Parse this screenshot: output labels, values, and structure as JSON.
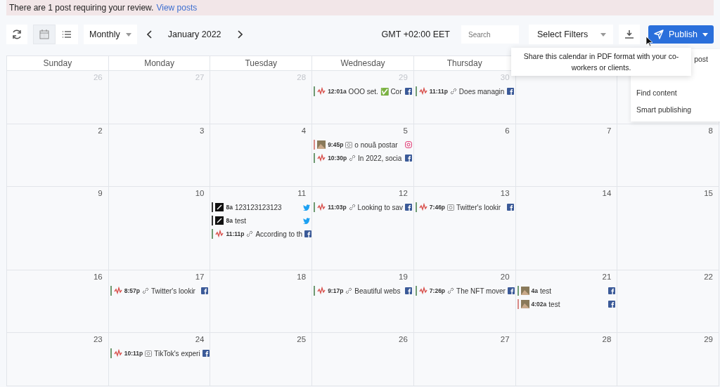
{
  "banner": {
    "text": "There are 1 post requiring your review.",
    "link": "View posts"
  },
  "toolbar": {
    "views": [
      {
        "kind": "calendar",
        "selected": true
      },
      {
        "kind": "list",
        "selected": false
      }
    ],
    "period": "Monthly",
    "month": "January 2022",
    "timezone": "GMT +02:00 EET",
    "search": {
      "placeholder": "Search"
    },
    "filters": "Select Filters",
    "publish": "Publish"
  },
  "tooltip": "Share this calendar in PDF format with your co-workers or clients.",
  "publish_menu": [
    "post",
    "Find content",
    "Smart publishing"
  ],
  "weekdays": [
    "Sunday",
    "Monday",
    "Tuesday",
    "Wednesday",
    "Thursday"
  ],
  "weeks": [
    [
      {
        "day": "26",
        "muted": true
      },
      {
        "day": "27",
        "muted": true
      },
      {
        "day": "28",
        "muted": true
      },
      {
        "day": "29",
        "muted": true,
        "posts": [
          {
            "time": "12:01a",
            "text": "OOO set. ✅ Cor",
            "avatar": {
              "kind": "logo"
            },
            "network": {
              "kind": "facebook"
            },
            "color": "#6f9a72"
          }
        ]
      },
      {
        "day": "30",
        "muted": true,
        "posts": [
          {
            "time": "11:11p",
            "text": "Does managin",
            "avatar": {
              "kind": "logo"
            },
            "media": {
              "kind": "link"
            },
            "network": {
              "kind": "facebook"
            },
            "color": "#6f9a72"
          }
        ]
      }
    ],
    [
      {
        "day": "2",
        "muted": false
      },
      {
        "day": "3",
        "muted": false
      },
      {
        "day": "4",
        "muted": false
      },
      {
        "day": "5",
        "muted": false,
        "posts": [
          {
            "time": "9:45p",
            "text": "o nouă postar",
            "avatar": {
              "kind": "photo"
            },
            "media": {
              "kind": "camera"
            },
            "network": {
              "kind": "instagram"
            },
            "color": "#d98a86"
          },
          {
            "time": "10:30p",
            "text": "In 2022, socia",
            "avatar": {
              "kind": "logo"
            },
            "media": {
              "kind": "link"
            },
            "network": {
              "kind": "facebook"
            },
            "color": "#6f9a72"
          }
        ]
      },
      {
        "day": "6",
        "muted": false
      },
      {
        "day": "7",
        "muted": false
      },
      {
        "day": "8",
        "muted": false
      }
    ],
    [
      {
        "day": "9",
        "muted": false
      },
      {
        "day": "10",
        "muted": false
      },
      {
        "day": "11",
        "muted": false,
        "posts": [
          {
            "time": "8a",
            "text": "123123123123",
            "avatar": {
              "kind": "dark"
            },
            "network": {
              "kind": "twitter"
            },
            "color": "#333333"
          },
          {
            "time": "8a",
            "text": "test",
            "avatar": {
              "kind": "dark"
            },
            "network": {
              "kind": "twitter"
            },
            "color": "#333333"
          },
          {
            "time": "11:11p",
            "text": "According to th",
            "avatar": {
              "kind": "logo"
            },
            "media": {
              "kind": "link"
            },
            "network": {
              "kind": "facebook"
            },
            "color": "#6f9a72"
          }
        ]
      },
      {
        "day": "12",
        "muted": false,
        "posts": [
          {
            "time": "11:03p",
            "text": "Looking to sav",
            "avatar": {
              "kind": "logo"
            },
            "media": {
              "kind": "link"
            },
            "network": {
              "kind": "facebook"
            },
            "color": "#6f9a72"
          }
        ]
      },
      {
        "day": "13",
        "muted": false,
        "posts": [
          {
            "time": "7:46p",
            "text": "Twitter's lookir",
            "avatar": {
              "kind": "logo"
            },
            "media": {
              "kind": "camera"
            },
            "network": {
              "kind": "facebook"
            },
            "color": "#6f9a72"
          }
        ]
      },
      {
        "day": "14",
        "muted": false
      },
      {
        "day": "15",
        "muted": false
      }
    ],
    [
      {
        "day": "16",
        "muted": false
      },
      {
        "day": "17",
        "muted": false,
        "posts": [
          {
            "time": "8:57p",
            "text": "Twitter's lookir",
            "avatar": {
              "kind": "logo"
            },
            "media": {
              "kind": "link"
            },
            "network": {
              "kind": "facebook"
            },
            "color": "#6f9a72"
          }
        ]
      },
      {
        "day": "18",
        "muted": false
      },
      {
        "day": "19",
        "muted": false,
        "posts": [
          {
            "time": "9:17p",
            "text": "Beautiful webs",
            "avatar": {
              "kind": "logo"
            },
            "media": {
              "kind": "link"
            },
            "network": {
              "kind": "facebook"
            },
            "color": "#6f9a72"
          }
        ]
      },
      {
        "day": "20",
        "muted": false,
        "posts": [
          {
            "time": "7:26p",
            "text": "The NFT mover",
            "avatar": {
              "kind": "logo"
            },
            "media": {
              "kind": "link"
            },
            "network": {
              "kind": "facebook"
            },
            "color": "#6f9a72"
          }
        ]
      },
      {
        "day": "21",
        "muted": false,
        "posts": [
          {
            "time": "4a",
            "text": "test",
            "avatar": {
              "kind": "photo"
            },
            "network": {
              "kind": "facebook"
            },
            "color": "#6f9a72"
          },
          {
            "time": "4:02a",
            "text": "test",
            "avatar": {
              "kind": "photo"
            },
            "network": {
              "kind": "facebook"
            },
            "color": "#d98a86"
          }
        ]
      },
      {
        "day": "22",
        "muted": false
      }
    ],
    [
      {
        "day": "23",
        "muted": false
      },
      {
        "day": "24",
        "muted": false,
        "posts": [
          {
            "time": "10:11p",
            "text": "TikTok's experi",
            "avatar": {
              "kind": "logo"
            },
            "media": {
              "kind": "camera"
            },
            "network": {
              "kind": "facebook"
            },
            "color": "#6f9a72"
          }
        ]
      },
      {
        "day": "25",
        "muted": false
      },
      {
        "day": "26",
        "muted": false
      },
      {
        "day": "27",
        "muted": false
      },
      {
        "day": "28",
        "muted": false
      },
      {
        "day": "29",
        "muted": false
      }
    ]
  ]
}
